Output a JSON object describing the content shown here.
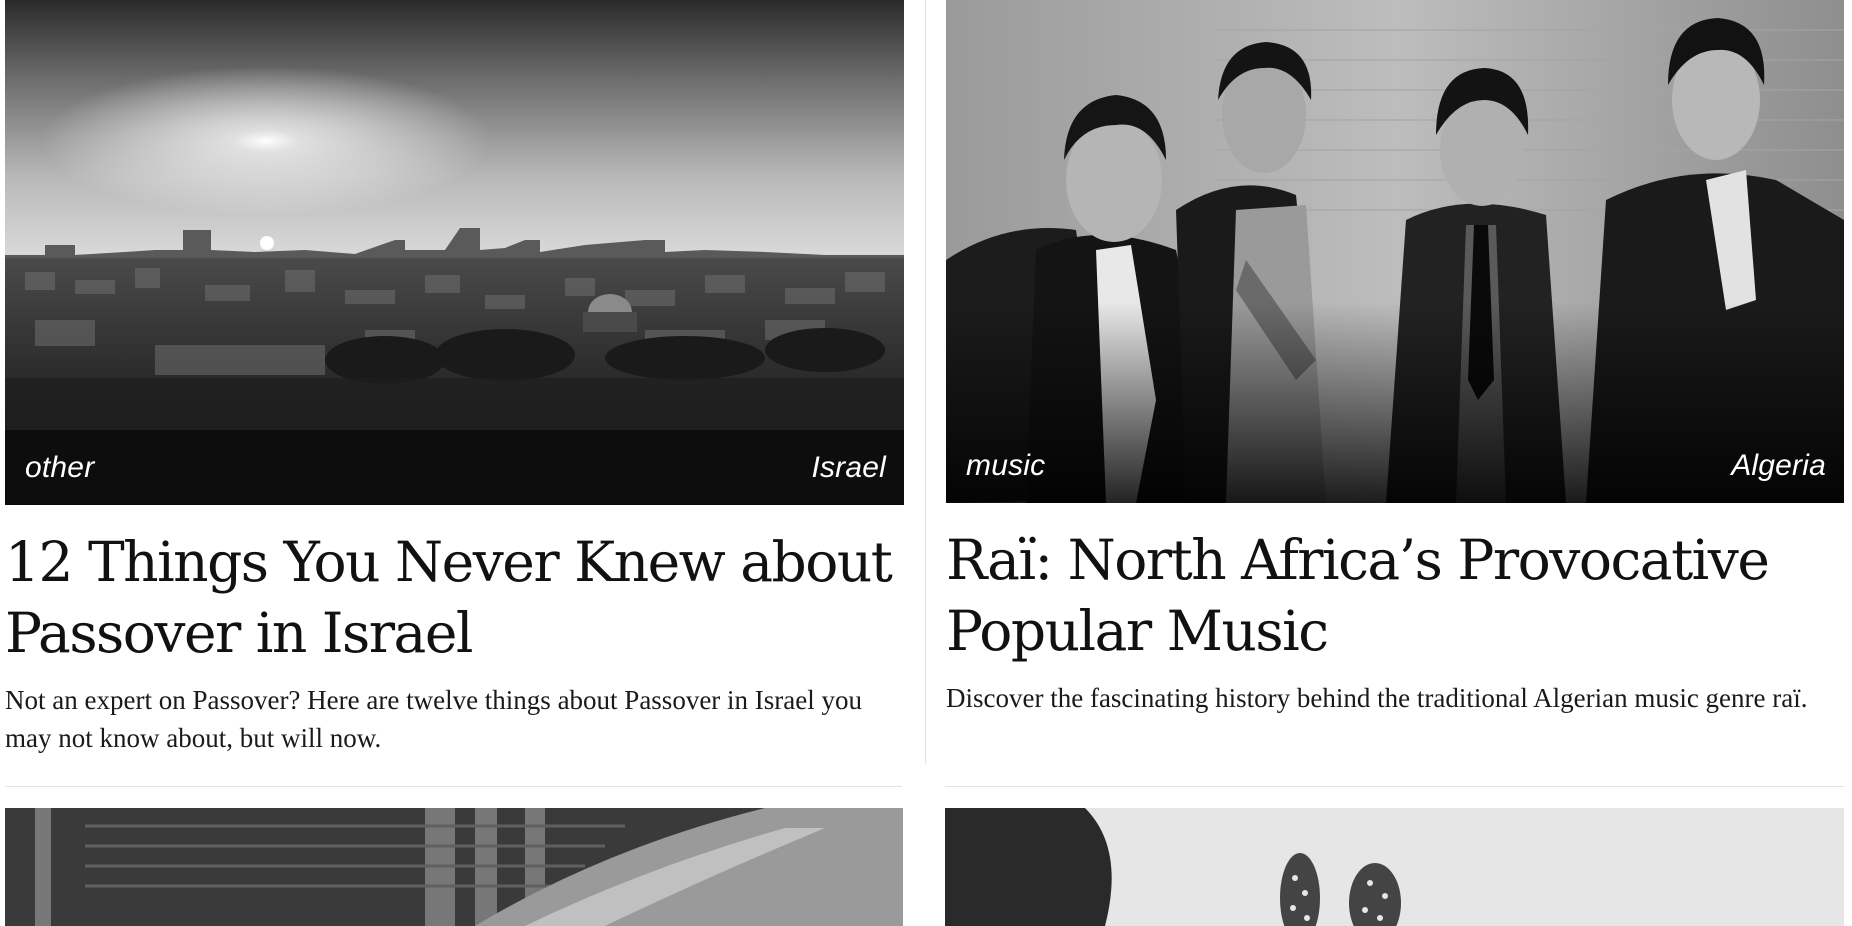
{
  "articles": [
    {
      "category": "other",
      "country": "Israel",
      "title": "12 Things You Never Knew about Passover in Israel",
      "description": "Not an expert on Passover? Here are twelve things about Passover in Israel you may not know about, but will now."
    },
    {
      "category": "music",
      "country": "Algeria",
      "title": "Raï: North Africa’s Provocative Popular Music",
      "description": "Discover the fascinating history behind the traditional Algerian music genre raï."
    }
  ],
  "colors": {
    "background": "#ffffff",
    "text": "#111111",
    "divider": "#e3e3e3",
    "tag_text": "#ffffff"
  }
}
